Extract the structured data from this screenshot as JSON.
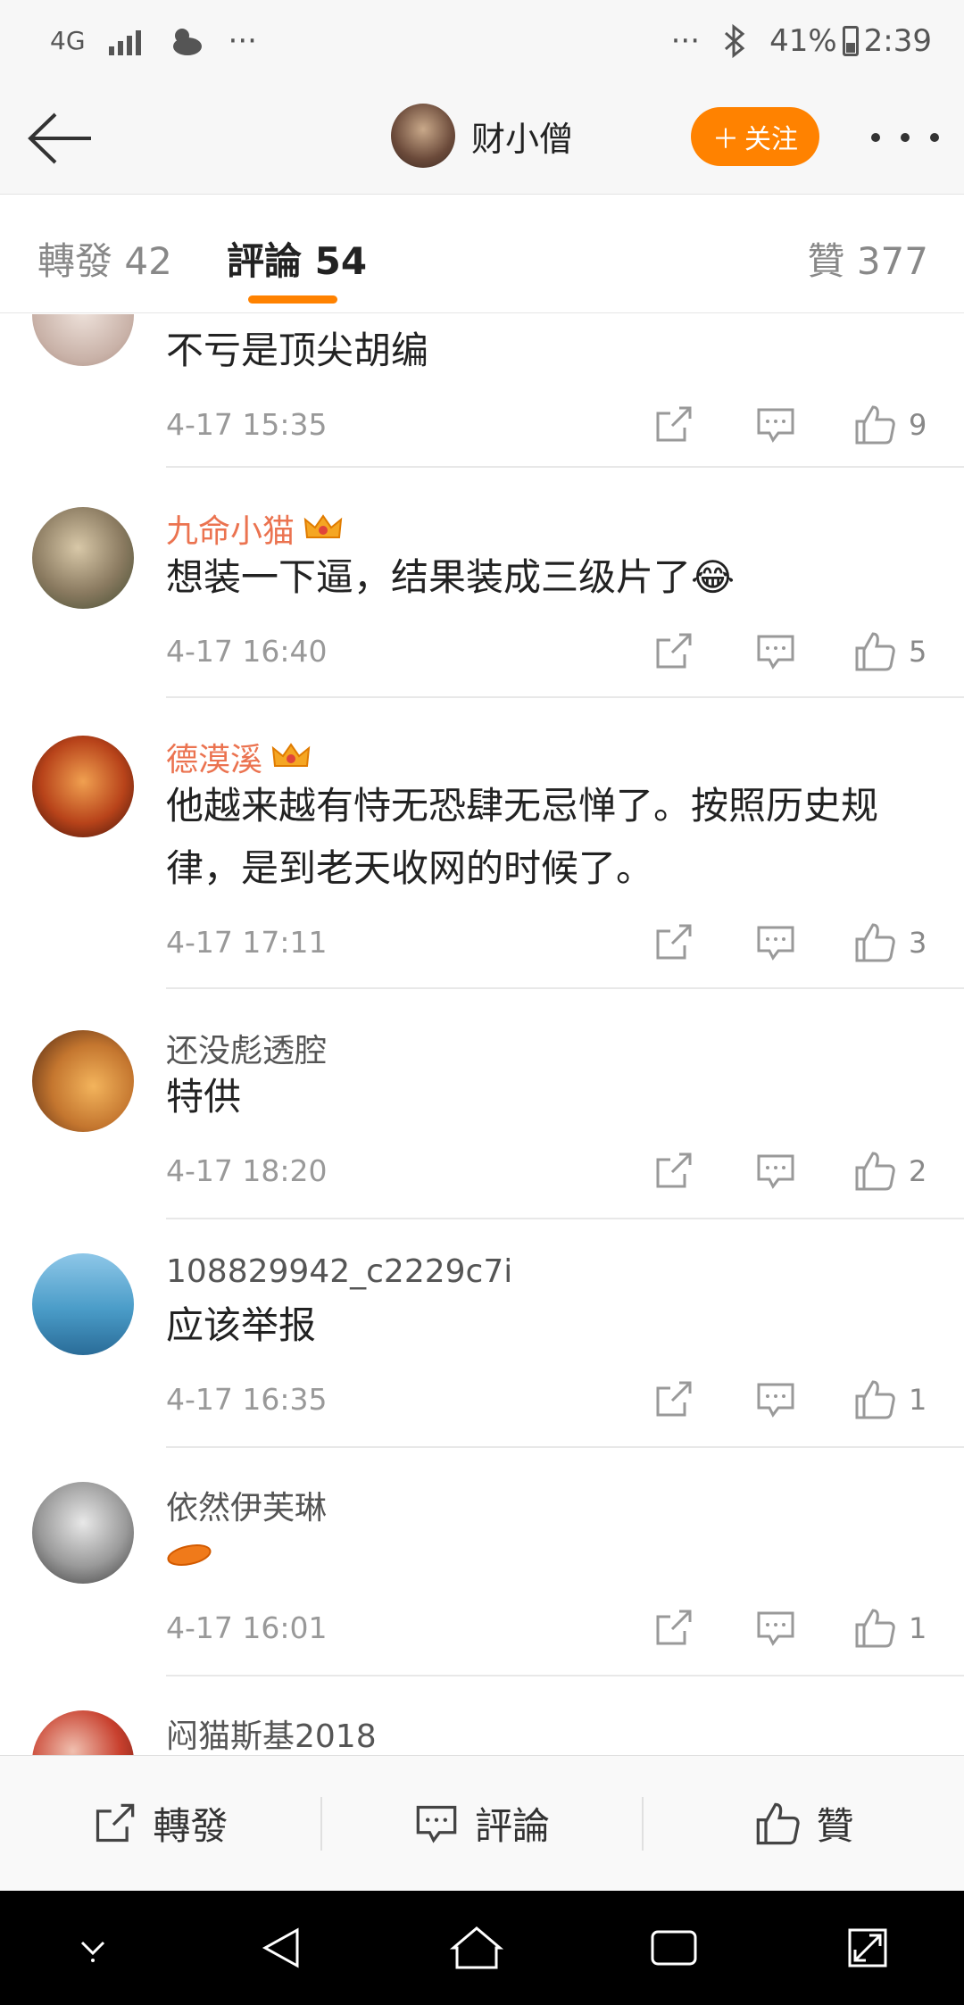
{
  "status_bar": {
    "network": "4G",
    "left_dots": "···",
    "right_dots": "···",
    "battery": "41%",
    "time": "2:39"
  },
  "nav": {
    "title": "财小僧",
    "follow_label": "关注"
  },
  "tabs": {
    "repost": "轉發 42",
    "comment": "評論 54",
    "like": "贊 377"
  },
  "comments": [
    {
      "user": "",
      "vip": false,
      "text": "不亏是顶尖胡编",
      "time": "4-17 15:35",
      "likes": "9",
      "avatar_color": "#d9c9c0"
    },
    {
      "user": "九命小猫",
      "vip": true,
      "text": "想装一下逼，结果装成三级片了😂",
      "time": "4-17 16:40",
      "likes": "5",
      "avatar_color": "#8a7a60"
    },
    {
      "user": "德漠溪",
      "vip": true,
      "text": "他越来越有恃无恐肆无忌惮了。按照历史规律，是到老天收网的时候了。",
      "time": "4-17 17:11",
      "likes": "3",
      "avatar_color": "#b8431a"
    },
    {
      "user": "还没彪透腔",
      "vip": false,
      "text": "特供",
      "time": "4-17 18:20",
      "likes": "2",
      "avatar_color": "#c4762f"
    },
    {
      "user": "108829942_c2229c7i",
      "vip": false,
      "text": "应该举报",
      "time": "4-17 16:35",
      "likes": "1",
      "avatar_color": "#4a9cc8"
    },
    {
      "user": "依然伊芙琳",
      "vip": false,
      "text": "",
      "time": "4-17 16:01",
      "likes": "1",
      "avatar_color": "#9a9a9a"
    },
    {
      "user": "闷猫斯基2018",
      "vip": false,
      "text": "",
      "time": "",
      "likes": "",
      "avatar_color": "#c8402e"
    }
  ],
  "bottom_bar": {
    "repost": "轉發",
    "comment": "評論",
    "like": "贊"
  },
  "icons": {
    "share": "share-icon",
    "reply": "reply-icon",
    "like": "thumbs-up-icon",
    "crown": "crown-icon",
    "back": "back-arrow-icon"
  },
  "colors": {
    "accent": "#ff8200",
    "vip_name": "#eb7350"
  }
}
